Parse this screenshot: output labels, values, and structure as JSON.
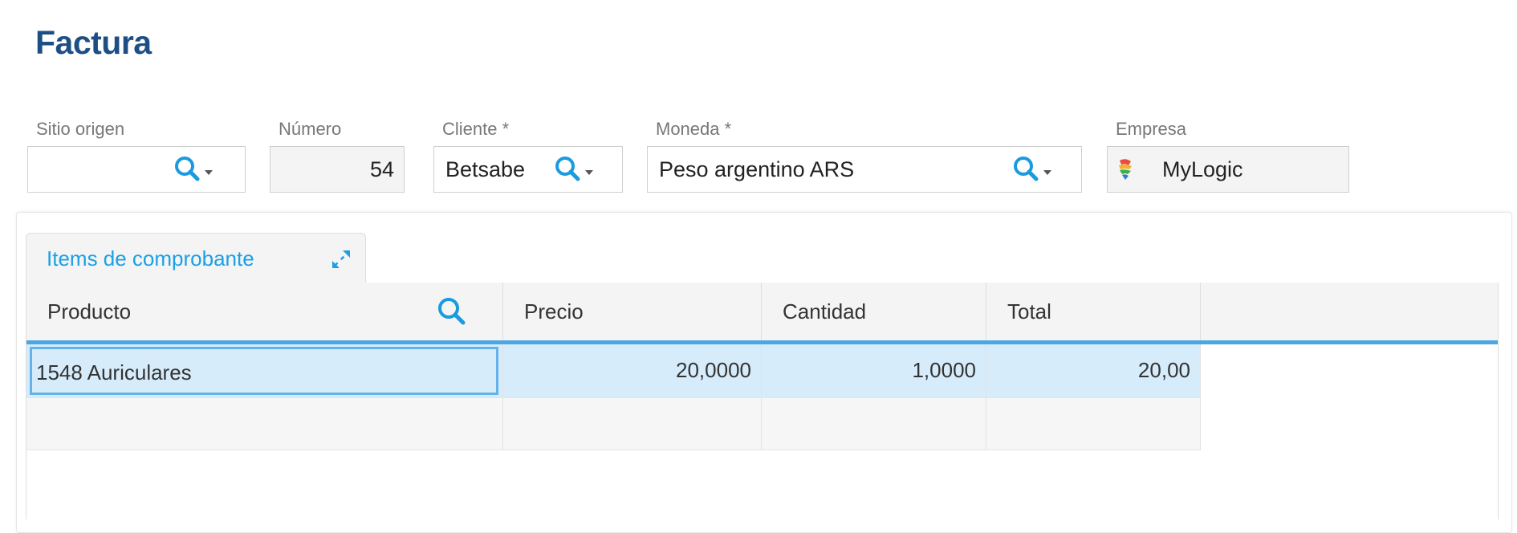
{
  "page": {
    "title": "Factura"
  },
  "header_fields": {
    "sitio_origen": {
      "label": "Sitio origen",
      "value": ""
    },
    "numero": {
      "label": "Número",
      "value": "54"
    },
    "cliente": {
      "label": "Cliente *",
      "value": "Betsabe"
    },
    "moneda": {
      "label": "Moneda *",
      "value": "Peso argentino ARS"
    },
    "empresa": {
      "label": "Empresa",
      "value": "MyLogic"
    }
  },
  "tabs": [
    {
      "label": "Items de comprobante",
      "active": true
    }
  ],
  "grid": {
    "columns": [
      "Producto",
      "Precio",
      "Cantidad",
      "Total"
    ],
    "rows": [
      {
        "producto": "1548 Auriculares",
        "precio": "20,0000",
        "cantidad": "1,0000",
        "total": "20,00"
      },
      {
        "producto": "",
        "precio": "",
        "cantidad": "",
        "total": ""
      }
    ]
  },
  "colors": {
    "title": "#1d4f86",
    "accent": "#1aa0e6",
    "search_icon": "#1a9be0",
    "header_rule": "#4aa7e2",
    "selected_row": "#d6ecfb"
  },
  "icons": {
    "lookup": "search-icon",
    "dropdown": "caret-down-icon",
    "expand": "expand-icon",
    "company": "company-logo-icon"
  }
}
